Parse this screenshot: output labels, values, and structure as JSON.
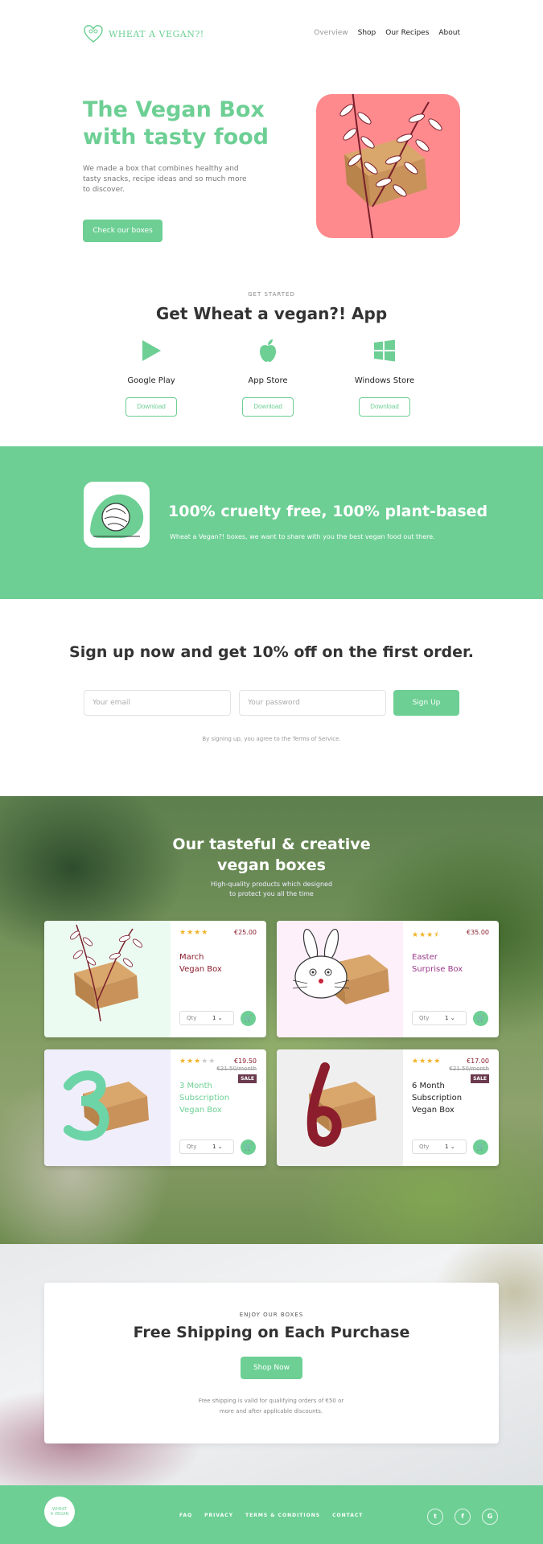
{
  "header": {
    "logo_text": "WHEAT A VEGAN?!",
    "nav": [
      {
        "label": "Overview"
      },
      {
        "label": "Shop"
      },
      {
        "label": "Our Recipes"
      },
      {
        "label": "About"
      }
    ]
  },
  "hero": {
    "title": "The Vegan Box with tasty food",
    "text": "We made a box that combines healthy and tasty snacks, recipe ideas and so much more to discover.",
    "button": "Check our boxes",
    "art_bg": "#ff8a8e"
  },
  "app": {
    "eyebrow": "GET STARTED",
    "title": "Get Wheat a vegan?! App",
    "stores": [
      {
        "name": "Google Play",
        "icon": "play-icon",
        "button": "Download"
      },
      {
        "name": "App Store",
        "icon": "apple-icon",
        "button": "Download"
      },
      {
        "name": "Windows Store",
        "icon": "windows-icon",
        "button": "Download"
      }
    ]
  },
  "banner": {
    "title": "100% cruelty free, 100% plant-based",
    "text": "Wheat a Vegan?! boxes, we want to share with you the best vegan food out there."
  },
  "signup": {
    "title": "Sign up now and get 10% off on the first order.",
    "email_placeholder": "Your email",
    "password_placeholder": "Your password",
    "button": "Sign Up",
    "terms": "By signing up, you agree to the Terms of Service."
  },
  "boxes": {
    "title_line1": "Our tasteful & creative",
    "title_line2": "vegan boxes",
    "subtitle_line1": "High-quality products which designed",
    "subtitle_line2": "to protect you all the time",
    "qty_label": "Qty",
    "cards": [
      {
        "name_line1": "March",
        "name_line2": "Vegan Box",
        "name_line3": "",
        "price": "€25.00",
        "old_price": "",
        "sale": "",
        "rating": 4,
        "qty": "1",
        "name_color": "#8b1d2c",
        "img_bg": "#ecfbf1"
      },
      {
        "name_line1": "Easter",
        "name_line2": "Surprise Box",
        "name_line3": "",
        "price": "€35.00",
        "old_price": "",
        "sale": "",
        "rating": 3.5,
        "qty": "1",
        "name_color": "#9b3a8a",
        "img_bg": "#fdf0fa"
      },
      {
        "name_line1": "3 Month",
        "name_line2": "Subscription",
        "name_line3": "Vegan Box",
        "price": "€19.50",
        "old_price": "€21.50/month",
        "sale": "SALE",
        "rating": 3,
        "qty": "1",
        "name_color": "#6dcf94",
        "img_bg": "#f1eefb"
      },
      {
        "name_line1": "6 Month",
        "name_line2": "Subscription",
        "name_line3": "Vegan Box",
        "price": "€17.00",
        "old_price": "€21.50/month",
        "sale": "SALE",
        "rating": 4,
        "qty": "1",
        "name_color": "#222222",
        "img_bg": "#efefef"
      }
    ]
  },
  "shipping": {
    "eyebrow": "ENJOY OUR BOXES",
    "title": "Free Shipping on Each Purchase",
    "button": "Shop Now",
    "note_line1": "Free shipping is valid for qualifying orders of €50 or",
    "note_line2": "more and after applicable discounts."
  },
  "footer": {
    "logo_line1": "WHEAT",
    "logo_line2": "A VEGAN",
    "links": [
      "FAQ",
      "PRIVACY",
      "TERMS & CONDITIONS",
      "CONTACT"
    ],
    "social": [
      {
        "icon": "twitter-icon",
        "glyph": "t"
      },
      {
        "icon": "facebook-icon",
        "glyph": "f"
      },
      {
        "icon": "google-icon",
        "glyph": "G"
      }
    ]
  },
  "colors": {
    "accent": "#6dcf94",
    "hero_art": "#ff8a8e",
    "sale_badge": "#6b3a4e",
    "price": "#8b1d2c"
  }
}
